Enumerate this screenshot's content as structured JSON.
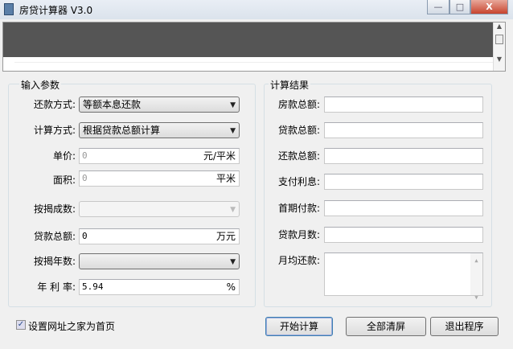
{
  "window": {
    "title": "房贷计算器 V3.0",
    "minimize": "—",
    "maximize": "□",
    "close": "X"
  },
  "input_group": {
    "title": "输入参数",
    "repay_method": {
      "label": "还款方式:",
      "value": "等额本息还款"
    },
    "calc_method": {
      "label": "计算方式:",
      "value": "根据贷款总额计算"
    },
    "unit_price": {
      "label": "单价:",
      "value": "0",
      "unit": "元/平米"
    },
    "area": {
      "label": "面积:",
      "value": "0",
      "unit": "平米"
    },
    "mortgage_ratio": {
      "label": "按揭成数:",
      "value": ""
    },
    "loan_total": {
      "label": "贷款总额:",
      "value": "0",
      "unit": "万元"
    },
    "mortgage_years": {
      "label": "按揭年数:",
      "value": ""
    },
    "annual_rate": {
      "label": "年 利 率:",
      "value": "5.94",
      "unit": "%"
    }
  },
  "result_group": {
    "title": "计算结果",
    "fields": [
      {
        "label": "房款总额:",
        "value": ""
      },
      {
        "label": "贷款总额:",
        "value": ""
      },
      {
        "label": "还款总额:",
        "value": ""
      },
      {
        "label": "支付利息:",
        "value": ""
      },
      {
        "label": "首期付款:",
        "value": ""
      },
      {
        "label": "贷款月数:",
        "value": ""
      }
    ],
    "monthly": {
      "label": "月均还款:",
      "value": ""
    }
  },
  "homepage_checkbox": {
    "label": "设置网址之家为首页",
    "checked": true
  },
  "buttons": {
    "start": "开始计算",
    "clear": "全部清屏",
    "exit": "退出程序"
  }
}
